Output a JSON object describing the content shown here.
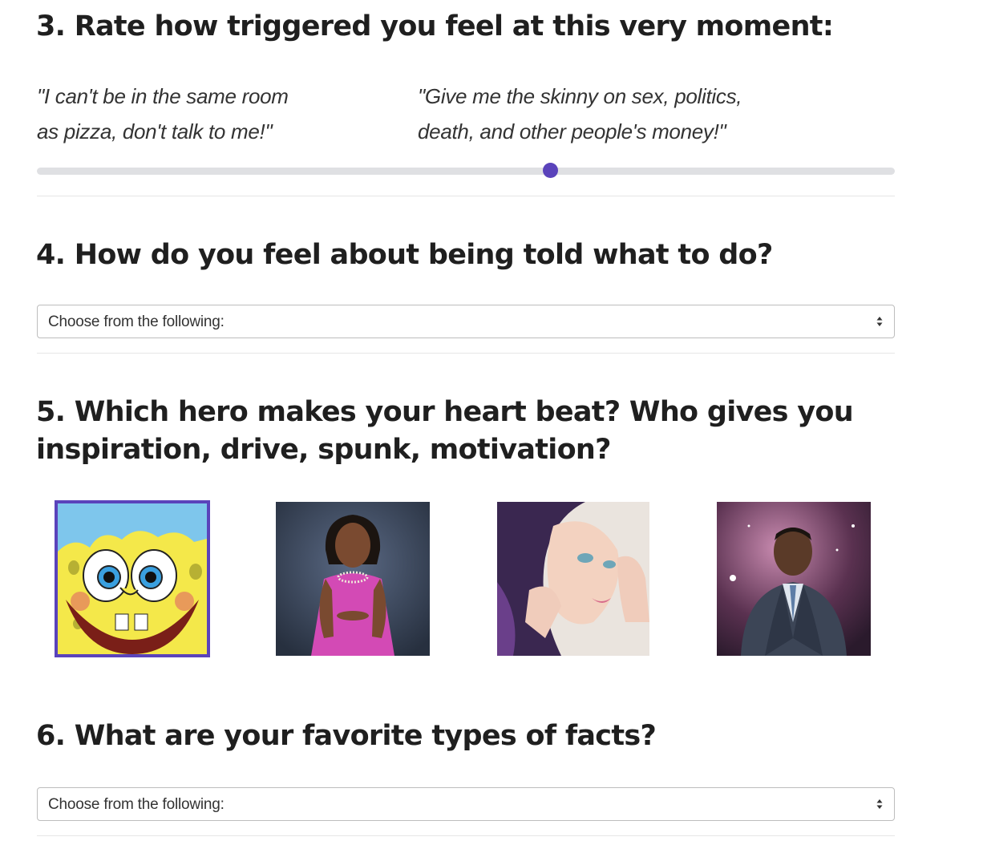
{
  "q3": {
    "title": "3. Rate how triggered you feel at this very moment:",
    "left_label": "\"I can't be in the same room\nas pizza, don't talk to me!\"",
    "right_label": "\"Give me the skinny on sex, politics,\ndeath, and other people's money!\"",
    "slider_value": 0.6,
    "accent_color": "#5a43bb"
  },
  "q4": {
    "title": "4. How do you feel about being told what to do?",
    "select_value": "Choose from the following:"
  },
  "q5": {
    "title_line1": "5. Which hero makes your heart beat? Who gives you",
    "title_line2": "inspiration, drive, spunk, motivation?",
    "heroes": [
      {
        "icon": "spongebob-image",
        "selected": true
      },
      {
        "icon": "woman-in-pink-dress-image",
        "selected": false
      },
      {
        "icon": "woman-with-purple-hair-image",
        "selected": false
      },
      {
        "icon": "man-in-suit-space-image",
        "selected": false
      }
    ]
  },
  "q6": {
    "title": "6. What are your favorite types of facts?",
    "select_value": "Choose from the following:"
  }
}
